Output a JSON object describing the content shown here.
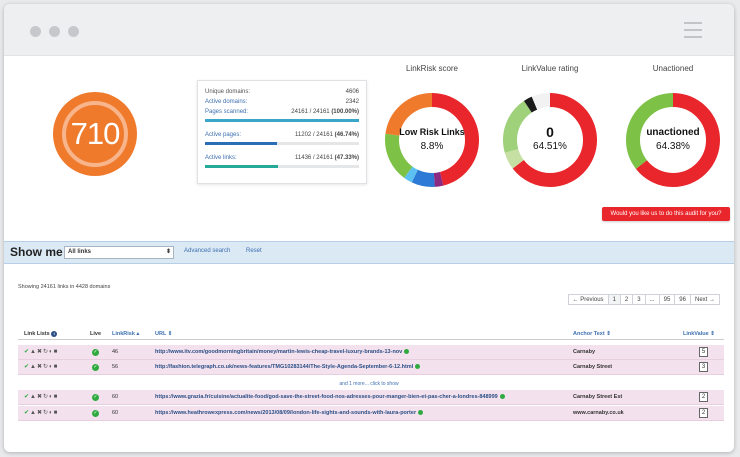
{
  "main_score": {
    "value": "710",
    "color": "#f07a2c"
  },
  "stats": {
    "unique_domains": {
      "label": "Unique domains:",
      "value": "4606"
    },
    "active_domains": {
      "label": "Active domains:",
      "value": "2342"
    },
    "pages_scanned": {
      "label": "Pages scanned:",
      "value": "24161 / 24161",
      "pct": "(100.00%)",
      "fraction": 1.0,
      "color": "#3aa6c9"
    },
    "active_pages": {
      "label": "Active pages:",
      "value": "11202 / 24161",
      "pct": "(46.74%)",
      "fraction": 0.4674,
      "color": "#2a6fb5"
    },
    "active_links": {
      "label": "Active links:",
      "value": "11436 / 24161",
      "pct": "(47.33%)",
      "fraction": 0.4733,
      "color": "#25a999"
    }
  },
  "gauges": [
    {
      "title": "LinkRisk score",
      "big": "Low Risk Links",
      "pct": "8.8%",
      "segments": [
        {
          "color": "#e8262b",
          "value": 0.46
        },
        {
          "color": "#8c2a82",
          "value": 0.03
        },
        {
          "color": "#2c7ad6",
          "value": 0.08
        },
        {
          "color": "#5cc1f0",
          "value": 0.03
        },
        {
          "color": "#7dc247",
          "value": 0.17
        },
        {
          "color": "#f07a2c",
          "value": 0.23
        }
      ]
    },
    {
      "title": "LinkValue rating",
      "big": "0",
      "pct": "64.51%",
      "segments": [
        {
          "color": "#e8262b",
          "value": 0.645
        },
        {
          "color": "#c6e0a4",
          "value": 0.06
        },
        {
          "color": "#9fd07a",
          "value": 0.2
        },
        {
          "color": "#1a1a1a",
          "value": 0.03
        },
        {
          "color": "#f2f2f2",
          "value": 0.065
        }
      ]
    },
    {
      "title": "Unactioned",
      "big": "unactioned",
      "pct": "64.38%",
      "segments": [
        {
          "color": "#e8262b",
          "value": 0.6438
        },
        {
          "color": "#7dc247",
          "value": 0.3562
        }
      ]
    }
  ],
  "cta": "Would you like us to do this audit for you?",
  "filter": {
    "label": "Show me",
    "selected": "All links",
    "advanced": "Advanced search",
    "reset": "Reset"
  },
  "results": {
    "showing": "Showing 24161 links in 4428 domains",
    "pager": [
      "← Previous",
      "1",
      "2",
      "3",
      "...",
      "95",
      "96",
      "Next →"
    ],
    "columns": {
      "link_lists": "Link Lists",
      "live": "Live",
      "linkrisk": "LinkRisk",
      "url": "URL",
      "anchor": "Anchor Text",
      "linkvalue": "LinkValue"
    },
    "rows": [
      {
        "risk": "46",
        "url": "http://www.itv.com/goodmorningbritain/money/martin-lewis-cheap-travel-luxury-brands-13-nov",
        "anchor": "Carnaby",
        "lv": "5"
      },
      {
        "risk": "56",
        "url": "http://fashion.telegraph.co.uk/news-features/TMG10283144/The-Style-Agenda-September-6-12.html",
        "anchor": "Carnaby Street",
        "lv": "3"
      },
      {
        "risk": "60",
        "url": "https://www.grazia.fr/cuisine/actualite-food/god-save-the-street-food-nos-adresses-pour-manger-bien-et-pas-cher-a-londres-848999",
        "anchor": "Carnaby Street Est",
        "lv": "2"
      },
      {
        "risk": "60",
        "url": "https://www.heathrowexpress.com/news/2013/08/09/london-life-sights-and-sounds-with-laura-porter",
        "anchor": "www.carnaby.co.uk",
        "lv": "2"
      }
    ],
    "more": "and 1 more... click to show"
  }
}
